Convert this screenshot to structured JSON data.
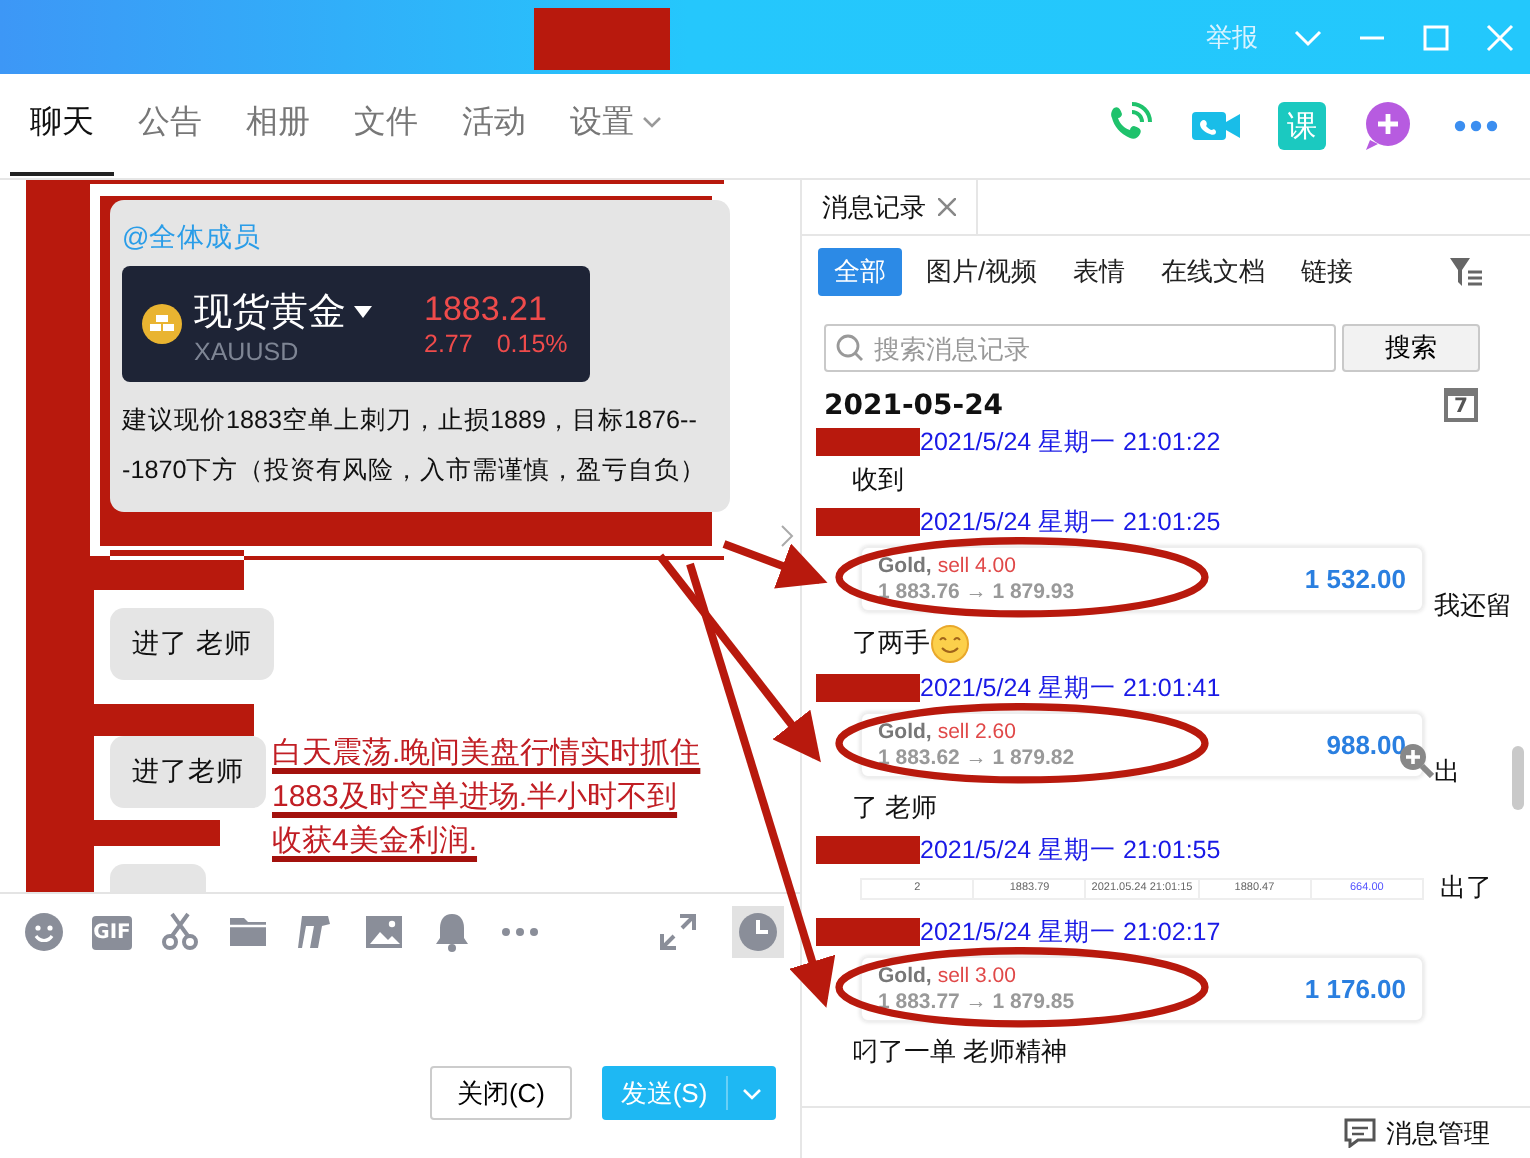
{
  "window": {
    "report": "举报"
  },
  "tabs": [
    {
      "label": "聊天",
      "selected": true
    },
    {
      "label": "公告",
      "selected": false
    },
    {
      "label": "相册",
      "selected": false
    },
    {
      "label": "文件",
      "selected": false
    },
    {
      "label": "活动",
      "selected": false
    },
    {
      "label": "设置",
      "selected": false,
      "dropdown": true
    }
  ],
  "actions": [
    {
      "kind": "phone"
    },
    {
      "kind": "video"
    },
    {
      "kind": "course",
      "text": "课"
    },
    {
      "kind": "add"
    },
    {
      "kind": "more"
    }
  ],
  "chat": {
    "messages": [
      {
        "kind": "card",
        "mention": "@全体成员",
        "quote": {
          "name": "现货黄金",
          "symbol": "XAUUSD",
          "price": "1883.21",
          "change": "2.77",
          "percent": "0.15%"
        },
        "text": "建议现价1883空单上刺刀，止损1889，目标1876---1870下方（投资有风险，入市需谨慎，盈亏自负）"
      },
      {
        "kind": "text",
        "text": "进了 老师"
      },
      {
        "kind": "text",
        "text": "进了老师"
      },
      {
        "kind": "stub"
      }
    ],
    "annotation": "白天震荡.晚间美盘行情实时抓住1883及时空单进场.半小时不到收获4美金利润."
  },
  "toolbar": [
    {
      "kind": "emoji"
    },
    {
      "kind": "gif",
      "text": "GIF"
    },
    {
      "kind": "scissors"
    },
    {
      "kind": "folder"
    },
    {
      "kind": "clip"
    },
    {
      "kind": "image"
    },
    {
      "kind": "bell"
    },
    {
      "kind": "more"
    }
  ],
  "toolbar_right": [
    {
      "kind": "expand",
      "selected": false
    },
    {
      "kind": "history",
      "selected": true
    }
  ],
  "buttons": {
    "close": "关闭(C)",
    "send": "发送(S)"
  },
  "history": {
    "tab": "消息记录",
    "filters": [
      {
        "label": "全部",
        "selected": true
      },
      {
        "label": "图片/视频",
        "selected": false
      },
      {
        "label": "表情",
        "selected": false
      },
      {
        "label": "在线文档",
        "selected": false
      },
      {
        "label": "链接",
        "selected": false
      }
    ],
    "search": {
      "placeholder": "搜索消息记录",
      "button": "搜索"
    },
    "date": "2021-05-24",
    "calendar_day": "7",
    "messages": [
      {
        "time": "2021/5/24 星期一 21:01:22",
        "parts": [
          {
            "kind": "text",
            "text": "收到"
          }
        ]
      },
      {
        "time": "2021/5/24 星期一 21:01:25",
        "parts": [
          {
            "kind": "trade",
            "symbol": "Gold,",
            "action": "sell 4.00",
            "prices": "1 883.76 → 1 879.93",
            "amount": "1 532.00",
            "zoom": false
          },
          {
            "kind": "text",
            "text": "我还留"
          },
          {
            "kind": "line",
            "text": "了两手"
          },
          {
            "kind": "emoji"
          }
        ]
      },
      {
        "time": "2021/5/24 星期一 21:01:41",
        "parts": [
          {
            "kind": "trade",
            "symbol": "Gold,",
            "action": "sell 2.60",
            "prices": "1 883.62 → 1 879.82",
            "amount": "988.00",
            "zoom": true
          },
          {
            "kind": "text",
            "text": "出"
          },
          {
            "kind": "line",
            "text": "了 老师"
          }
        ]
      },
      {
        "time": "2021/5/24 星期一 21:01:55",
        "parts": [
          {
            "kind": "strip",
            "cells": [
              "2",
              "1883.79",
              "2021.05.24 21:01:15",
              "1880.47",
              "664.00"
            ]
          },
          {
            "kind": "text",
            "text": "出了"
          }
        ]
      },
      {
        "time": "2021/5/24 星期一 21:02:17",
        "parts": [
          {
            "kind": "trade",
            "symbol": "Gold,",
            "action": "sell 3.00",
            "prices": "1 883.77 → 1 879.85",
            "amount": "1 176.00",
            "zoom": false
          },
          {
            "kind": "line",
            "text": "叼了一单 老师精神"
          }
        ]
      }
    ],
    "footer": "消息管理"
  }
}
